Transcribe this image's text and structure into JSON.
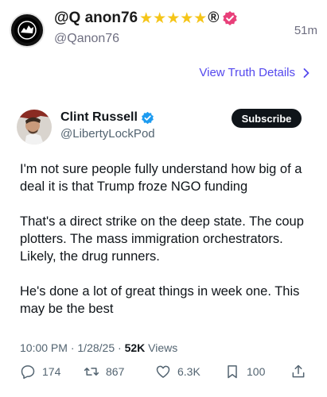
{
  "post": {
    "display_name": "@Q anon76",
    "handle": "@Qanon76",
    "time": "51m",
    "reg_mark": "®",
    "view_details_label": "View Truth Details"
  },
  "tweet": {
    "name": "Clint Russell",
    "handle": "@LibertyLockPod",
    "subscribe_label": "Subscribe",
    "paragraphs": [
      "I'm not sure people fully understand how big of a deal it is that Trump froze NGO funding",
      "That's a direct strike on the deep state. The coup plotters. The mass immigration orchestrators. Likely, the drug runners.",
      "He's done a lot of great things in week one. This may be the best"
    ],
    "time": "10:00 PM",
    "date": "1/28/25",
    "views_count": "52K",
    "views_label": "Views",
    "replies": "174",
    "retweets": "867",
    "likes": "6.3K",
    "bookmarks": "100"
  },
  "colors": {
    "accent": "#5448ee",
    "star": "#f5c518",
    "verified_pink": "#e8407a",
    "verified_blue": "#1d9bf0"
  }
}
